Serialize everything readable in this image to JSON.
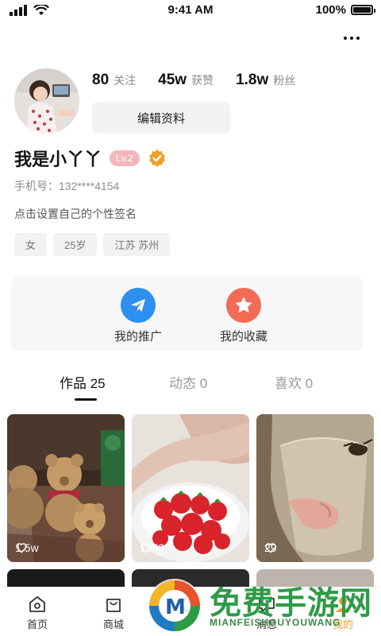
{
  "status_bar": {
    "time": "9:41 AM",
    "battery": "100%",
    "battery_level": 1.0
  },
  "profile": {
    "stats": [
      {
        "value": "80",
        "label": "关注"
      },
      {
        "value": "45w",
        "label": "获赞"
      },
      {
        "value": "1.8w",
        "label": "粉丝"
      }
    ],
    "edit_label": "编辑资料",
    "username": "我是小丫丫",
    "level": "Lv.2",
    "phone": "手机号：132****4154",
    "signature": "点击设置自己的个性签名",
    "tags": [
      "女",
      "25岁",
      "江苏 苏州"
    ]
  },
  "actions": [
    {
      "label": "我的推广",
      "icon": "paper-plane-icon",
      "color": "#2d8ff0"
    },
    {
      "label": "我的收藏",
      "icon": "star-icon",
      "color": "#f26b55"
    }
  ],
  "tabs": [
    {
      "label": "作品 25",
      "active": true
    },
    {
      "label": "动态 0",
      "active": false
    },
    {
      "label": "喜欢 0",
      "active": false
    }
  ],
  "posts": [
    {
      "likes": "1.5w",
      "subject": "teddy-bears"
    },
    {
      "likes": "1253",
      "subject": "strawberries"
    },
    {
      "likes": "29",
      "subject": "glass-of-drink"
    }
  ],
  "bottom_nav": [
    {
      "label": "首页",
      "icon": "home-icon"
    },
    {
      "label": "商城",
      "icon": "shopping-bag-icon"
    },
    {
      "label": "",
      "icon": "center-icon"
    },
    {
      "label": "消息",
      "icon": "message-icon"
    },
    {
      "label": "我的",
      "icon": "profile-icon"
    }
  ],
  "watermark": {
    "title": "免费手游网",
    "subtitle": "MIANFEISHOUYOUWANG"
  },
  "colors": {
    "accent_blue": "#2d8ff0",
    "accent_red": "#f26b55",
    "level_pink": "#f4b6bd",
    "verified_orange": "#f0a02a"
  }
}
